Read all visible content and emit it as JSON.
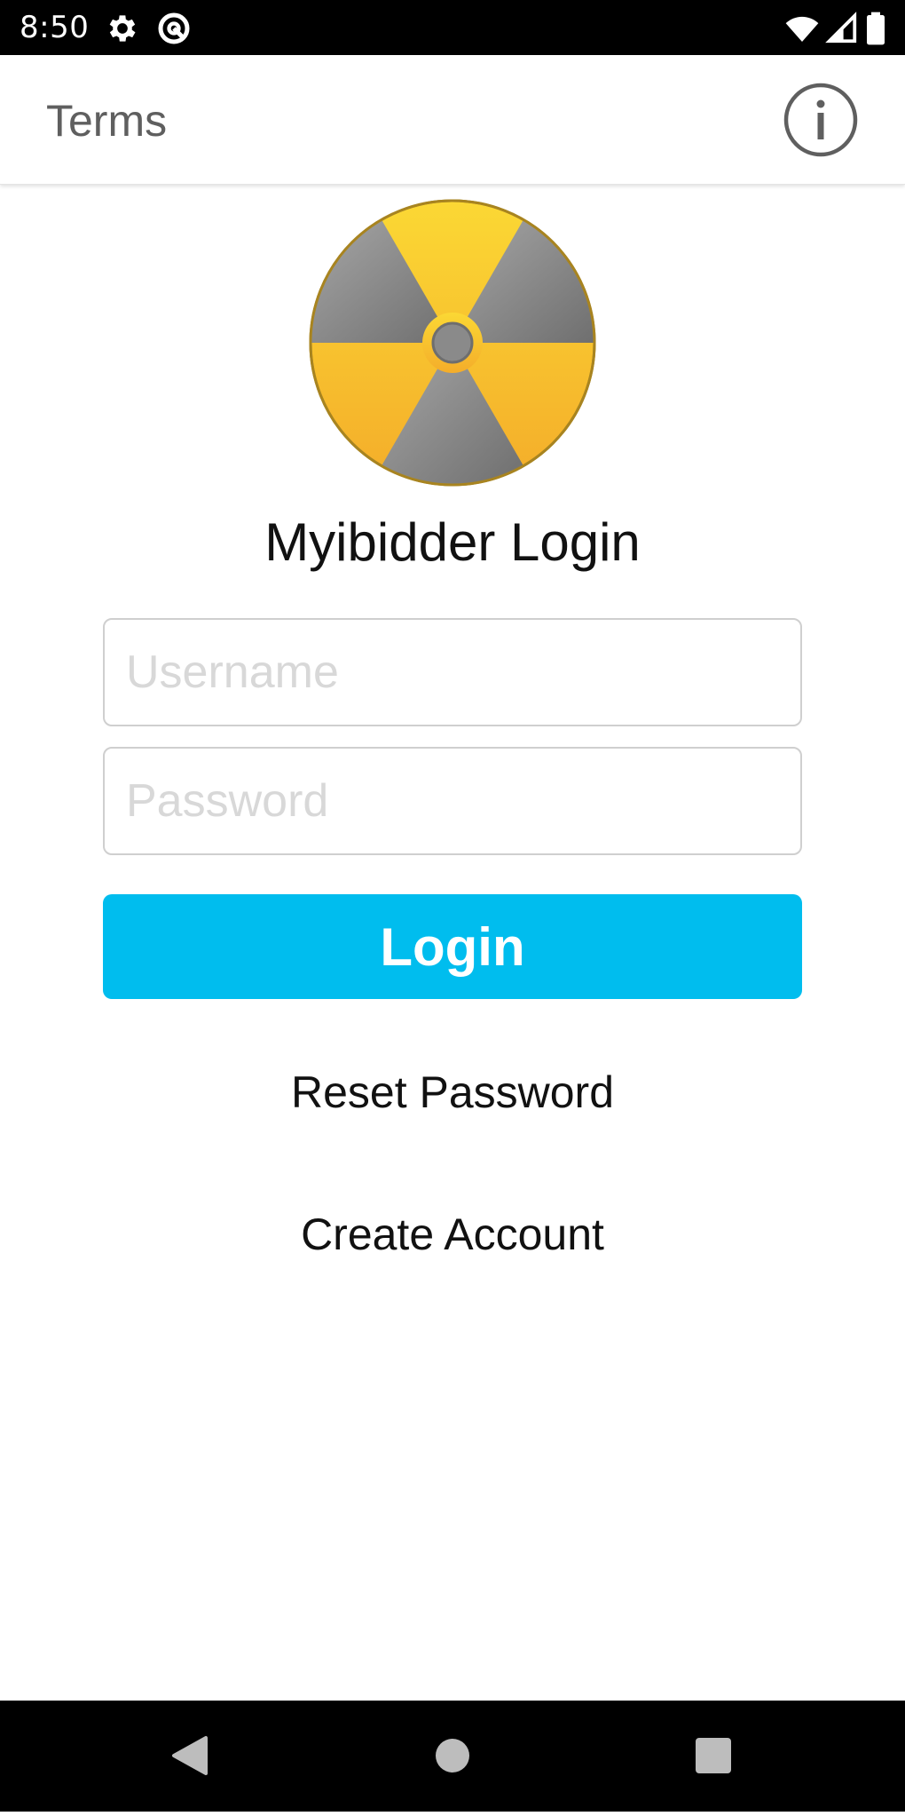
{
  "status_bar": {
    "time": "8:50",
    "icons": [
      "settings-gear-icon",
      "at-sign-icon",
      "wifi-icon",
      "signal-icon",
      "battery-icon"
    ]
  },
  "app_bar": {
    "terms_label": "Terms",
    "info_icon": "info-icon"
  },
  "logo": {
    "icon": "radiation-logo-icon",
    "colors": {
      "yellow": "#f7c22a",
      "gray": "#8a8a8a",
      "rim": "#b08a1c"
    }
  },
  "login": {
    "title": "Myibidder Login",
    "username_placeholder": "Username",
    "username_value": "",
    "password_placeholder": "Password",
    "password_value": "",
    "login_button_label": "Login",
    "reset_password_label": "Reset Password",
    "create_account_label": "Create Account"
  },
  "colors": {
    "accent": "#00bdee",
    "text": "#111111",
    "muted_text": "#5f5f5f",
    "placeholder": "#d8d8d8"
  },
  "nav_bar": {
    "buttons": [
      "back-icon",
      "home-icon",
      "recents-icon"
    ]
  }
}
